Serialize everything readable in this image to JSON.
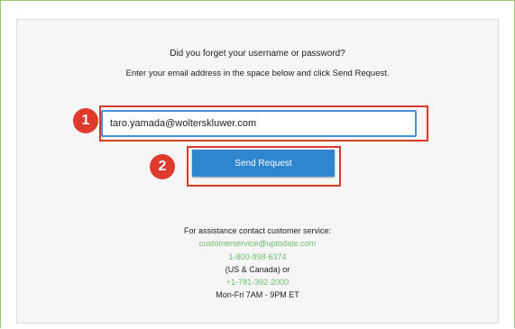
{
  "form": {
    "headline": "Did you forget your username or password?",
    "instructions": "Enter your email address in the space below and click Send Request.",
    "email_value": "taro.yamada@wolterskluwer.com",
    "send_label": "Send Request"
  },
  "annotations": {
    "step1": "1",
    "step2": "2"
  },
  "assistance": {
    "title": "For assistance contact customer service:",
    "email": "customerservice@uptodate.com",
    "phone_us": "1-800-998-6374",
    "region": "(US & Canada) or",
    "phone_intl": "+1-781-392-2000",
    "hours": "Mon-Fri 7AM - 9PM ET"
  },
  "colors": {
    "accent": "#2f86cf",
    "highlight": "#d93a2b",
    "link": "#6cbf6c"
  }
}
